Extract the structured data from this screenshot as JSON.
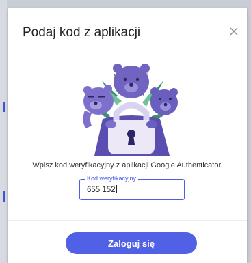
{
  "dialog": {
    "title": "Podaj kod z aplikacji",
    "close_icon": "close-icon",
    "illustration": "bears-lock-illustration",
    "instruction": "Wpisz kod weryfikacyjny z aplikacji Google Authenticator.",
    "code_field": {
      "label": "Kod weryfikacyjny",
      "value": "655 152"
    },
    "login_button_label": "Zaloguj się"
  },
  "colors": {
    "accent": "#5161e6",
    "bear": "#7064c0",
    "lock": "#ece8f8",
    "leaves": "#3e8f6c"
  }
}
